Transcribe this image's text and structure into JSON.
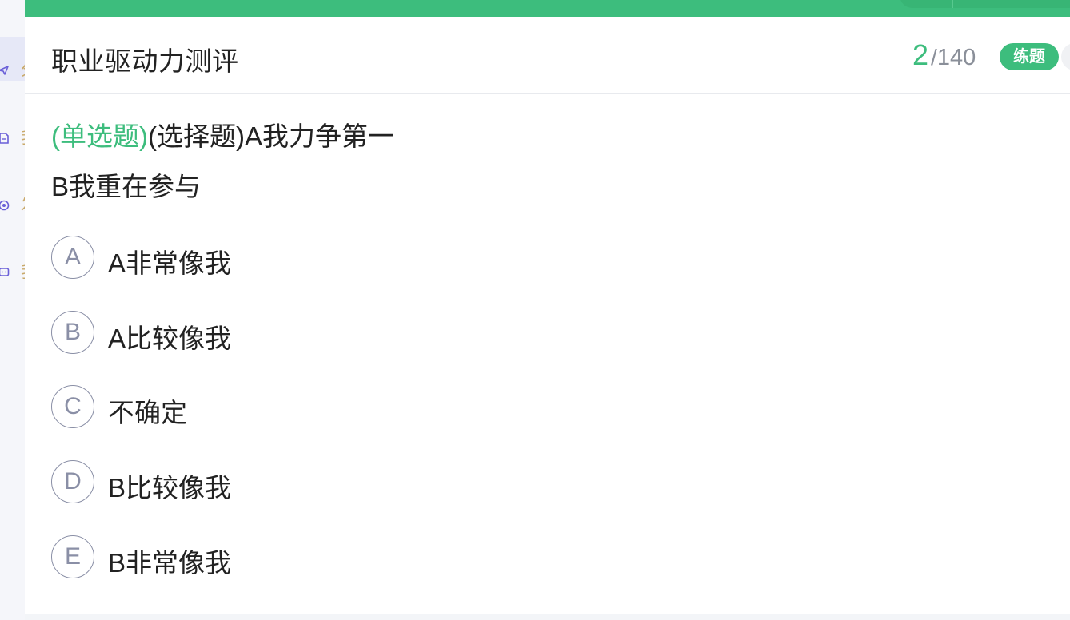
{
  "sidebar": {
    "items": [
      {
        "icon": "send-icon",
        "label_fragment": "分",
        "active": true
      },
      {
        "icon": "document-icon",
        "label_fragment": "我",
        "active": false
      },
      {
        "icon": "target-icon",
        "label_fragment": "发",
        "active": false
      },
      {
        "icon": "chat-icon",
        "label_fragment": "我",
        "active": false
      }
    ]
  },
  "header": {
    "title": "职业驱动力测评",
    "current": "2",
    "separator": "/",
    "total": "140",
    "mode_badge": "练题"
  },
  "question": {
    "type_tag": "(单选题)",
    "line1": "(选择题)A我力争第一",
    "line2": "B我重在参与"
  },
  "options": [
    {
      "letter": "A",
      "text": "A非常像我"
    },
    {
      "letter": "B",
      "text": "A比较像我"
    },
    {
      "letter": "C",
      "text": "不确定"
    },
    {
      "letter": "D",
      "text": "B比较像我"
    },
    {
      "letter": "E",
      "text": "B非常像我"
    }
  ],
  "colors": {
    "accent": "#3dbd7d",
    "text": "#222222",
    "muted": "#8a8f99",
    "sidebar_icon": "#6a5fd8"
  }
}
